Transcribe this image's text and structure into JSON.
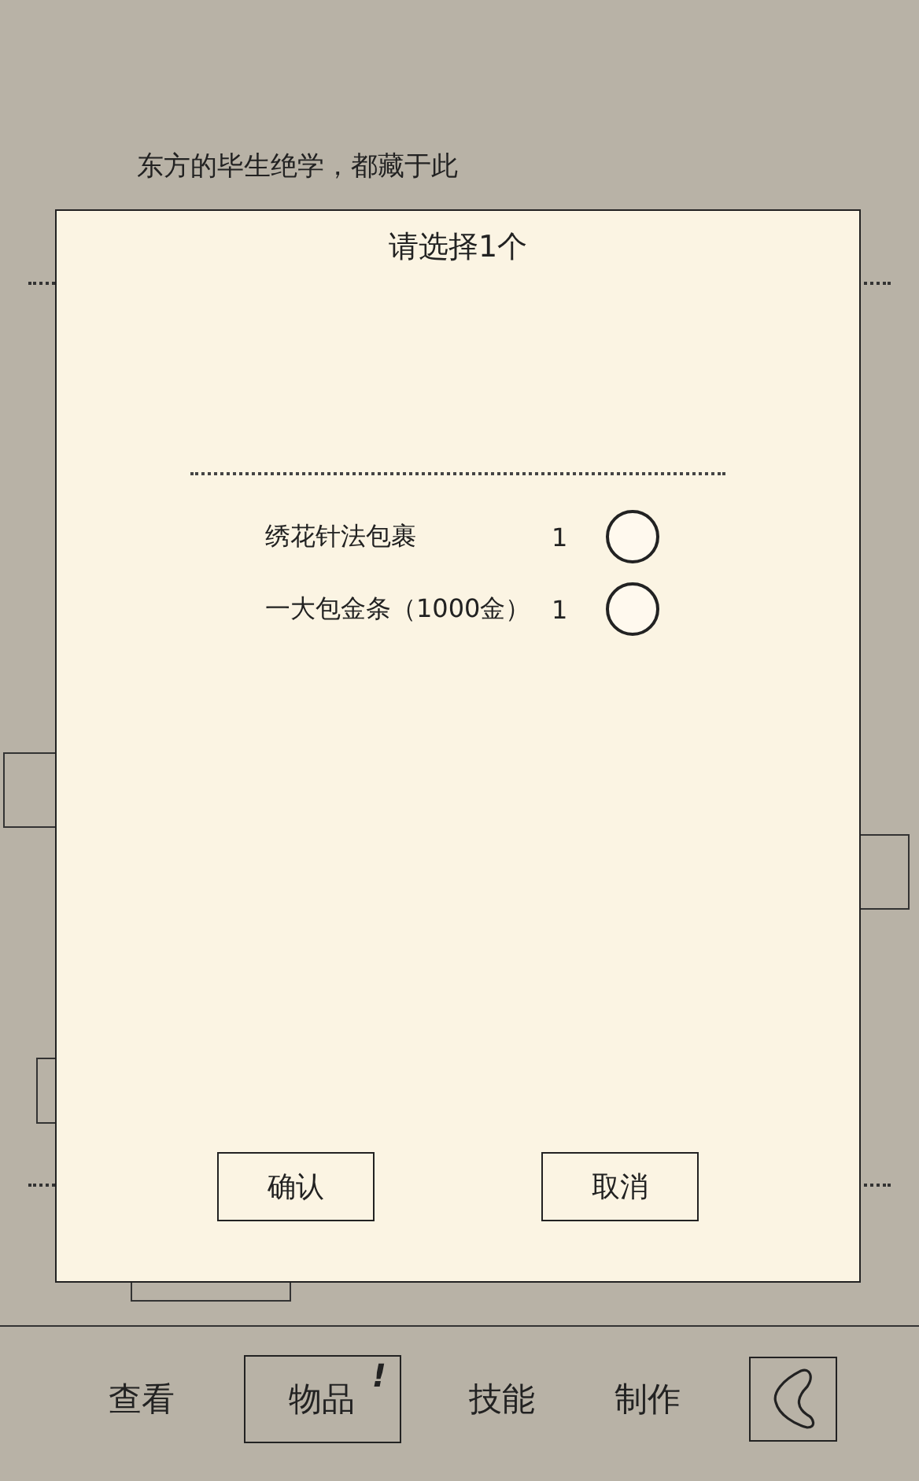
{
  "header": {
    "text": "东方的毕生绝学，都藏于此"
  },
  "dialog": {
    "title": "请选择1个",
    "options": [
      {
        "name": "绣花针法包裹",
        "count": "1",
        "selected": false
      },
      {
        "name": "一大包金条（1000金）",
        "count": "1",
        "selected": false
      }
    ],
    "buttons": [
      "确认",
      "取消"
    ]
  },
  "nav": [
    {
      "label": "查看",
      "selected": false
    },
    {
      "label": "物品",
      "selected": true,
      "badge": "!"
    },
    {
      "label": "技能",
      "selected": false
    },
    {
      "label": "制作",
      "selected": false
    }
  ]
}
